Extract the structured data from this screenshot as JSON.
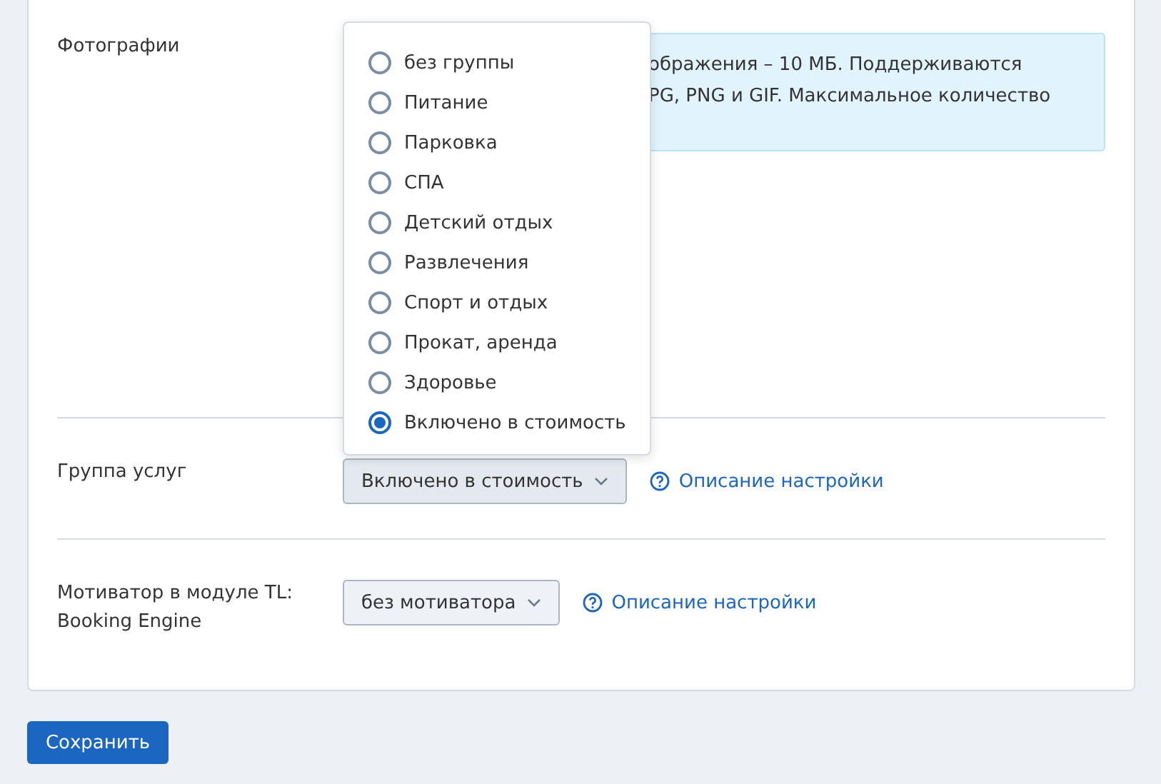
{
  "photos": {
    "label": "Фотографии",
    "info_lines": [
      "ображения – 10 МБ. Поддерживаются",
      "PG, PNG и GIF. Максимальное количество"
    ]
  },
  "service_group": {
    "label": "Группа услуг",
    "value": "Включено в стоимость",
    "help_link": "Описание настройки",
    "expanded": true,
    "options": [
      {
        "label": "без группы",
        "selected": false
      },
      {
        "label": "Питание",
        "selected": false
      },
      {
        "label": "Парковка",
        "selected": false
      },
      {
        "label": "СПА",
        "selected": false
      },
      {
        "label": "Детский отдых",
        "selected": false
      },
      {
        "label": "Развлечения",
        "selected": false
      },
      {
        "label": "Спорт и отдых",
        "selected": false
      },
      {
        "label": "Прокат, аренда",
        "selected": false
      },
      {
        "label": "Здоровье",
        "selected": false
      },
      {
        "label": "Включено в стоимость",
        "selected": true
      }
    ]
  },
  "motivator": {
    "label": "Мотиватор в модуле TL: Booking Engine",
    "value": "без мотиватора",
    "help_link": "Описание настройки"
  },
  "save_button": "Сохранить"
}
